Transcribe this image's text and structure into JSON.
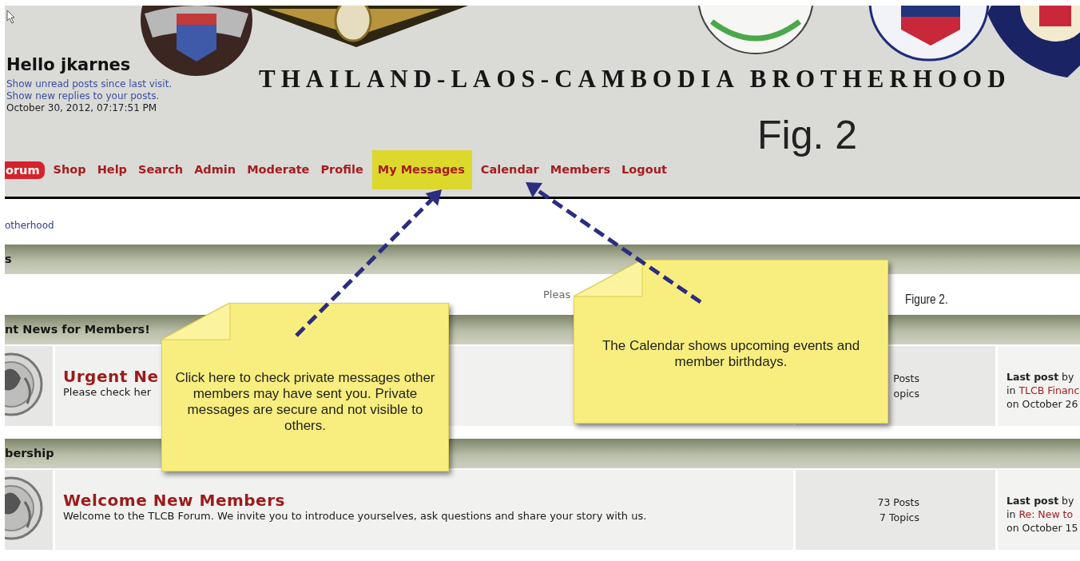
{
  "header": {
    "greeting": "Hello jkarnes",
    "links": [
      "Show unread posts since last visit.",
      "Show new replies to your posts."
    ],
    "datetime": "October 30, 2012, 07:17:51 PM",
    "site_title": "THAILAND-LAOS-CAMBODIA BROTHERHOOD",
    "banner": {
      "kind": "picture"
    }
  },
  "figure_label": "Fig. 2",
  "nav": [
    {
      "label": "orum",
      "selected": true,
      "highlighted": false
    },
    {
      "label": "Shop",
      "selected": false,
      "highlighted": false
    },
    {
      "label": "Help",
      "selected": false,
      "highlighted": false
    },
    {
      "label": "Search",
      "selected": false,
      "highlighted": false
    },
    {
      "label": "Admin",
      "selected": false,
      "highlighted": false
    },
    {
      "label": "Moderate",
      "selected": false,
      "highlighted": false
    },
    {
      "label": "Profile",
      "selected": false,
      "highlighted": false
    },
    {
      "label": "My Messages",
      "selected": false,
      "highlighted": true
    },
    {
      "label": "Calendar",
      "selected": false,
      "highlighted": false
    },
    {
      "label": "Members",
      "selected": false,
      "highlighted": false
    },
    {
      "label": "Logout",
      "selected": false,
      "highlighted": false
    }
  ],
  "breadcrumb": "otherhood",
  "categories": [
    {
      "title": "s",
      "notice": "Pleas"
    },
    {
      "title": "nt News for Members!",
      "boards": [
        {
          "name": "Urgent Ne",
          "description": "Please check her",
          "posts": "Posts",
          "topics": "opics",
          "last_post": "**Last post** by",
          "last_post_in": "in",
          "last_post_topic": "TLCB Financ",
          "last_post_date": "on October 26"
        }
      ]
    },
    {
      "title": "bership",
      "boards": [
        {
          "name": "Welcome New Members",
          "description": "Welcome to the TLCB Forum. We invite you to introduce yourselves, ask questions and share your story with us.",
          "posts": "73 Posts",
          "topics": "7 Topics",
          "last_post": "**Last post** by",
          "last_post_in": "in",
          "last_post_topic": "Re: New to",
          "last_post_date": "on October 15"
        }
      ]
    }
  ],
  "figure_caption": "Figure 2.",
  "callouts": [
    {
      "text": "Click here to check private messages other members may have sent you. Private messages are secure and not visible to others."
    },
    {
      "text": "The Calendar shows upcoming events and member birthdays."
    }
  ]
}
